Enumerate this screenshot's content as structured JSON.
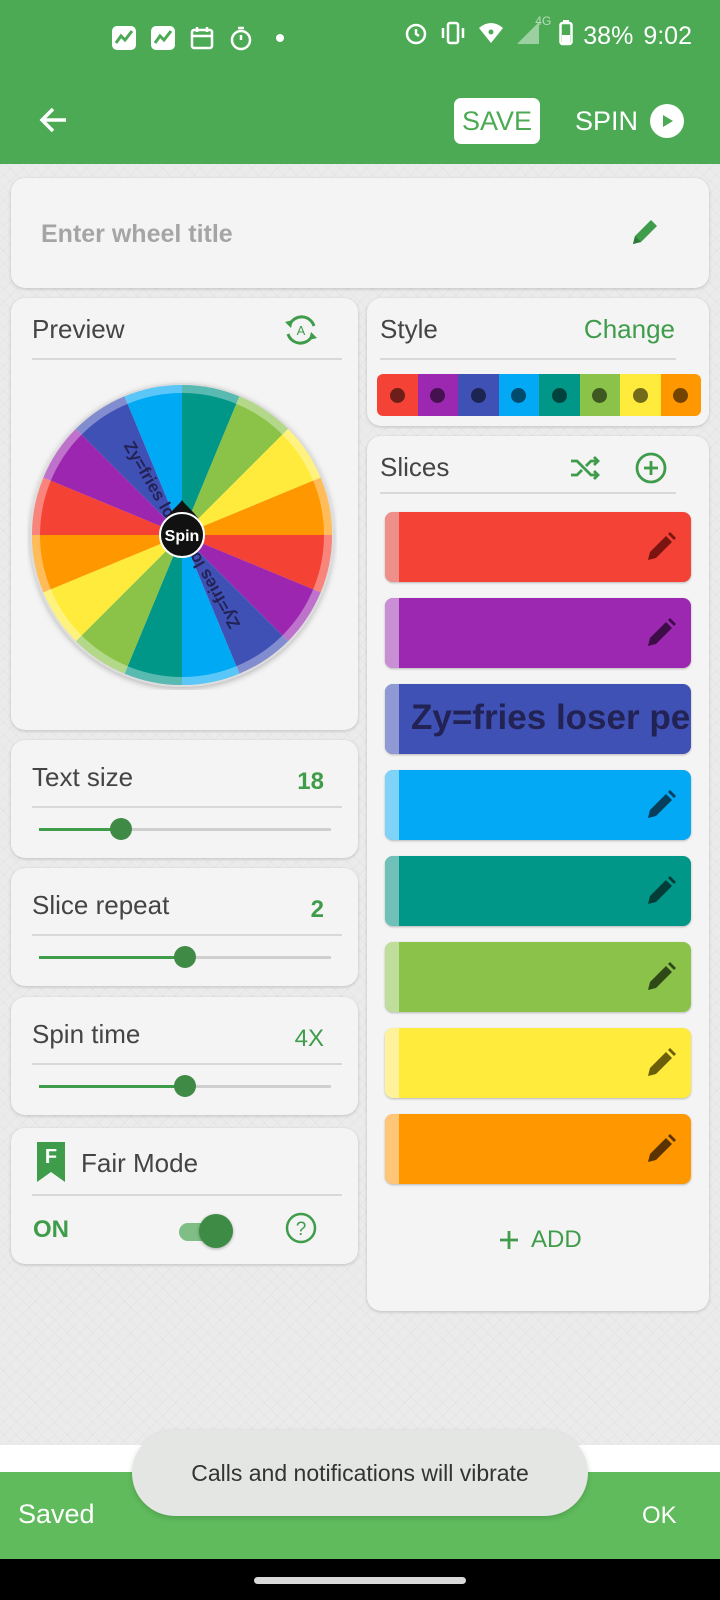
{
  "status_bar": {
    "battery": "38%",
    "time": "9:02",
    "network": "4G",
    "left_icons": [
      "chart-app-icon",
      "chart-app-icon",
      "calendar-icon",
      "timer-icon",
      "dot-icon"
    ],
    "right_icons": [
      "alarm-icon",
      "vibrate-icon",
      "wifi-icon",
      "signal-icon",
      "battery-icon"
    ]
  },
  "app_bar": {
    "save_label": "SAVE",
    "spin_label": "SPIN"
  },
  "title_field": {
    "placeholder": "Enter wheel title",
    "value": ""
  },
  "preview": {
    "title": "Preview",
    "center_label": "Spin",
    "wheel_text": "Zy=fries los"
  },
  "style": {
    "title": "Style",
    "change_label": "Change",
    "colors": [
      "#f44336",
      "#9c27b0",
      "#3f51b5",
      "#03a9f4",
      "#009688",
      "#8bc34a",
      "#ffeb3b",
      "#ff9800"
    ]
  },
  "slices": {
    "title": "Slices",
    "add_label": "ADD",
    "items": [
      {
        "color": "#f44336",
        "stripe": "#ee8f8a",
        "text": "",
        "pencil": "#7a1410"
      },
      {
        "color": "#9c27b0",
        "stripe": "#c98fd5",
        "text": "",
        "pencil": "#3d0d47"
      },
      {
        "color": "#3f51b5",
        "stripe": "#8f99d4",
        "text": "Zy=fries loser pe",
        "pencil": "#1a2150"
      },
      {
        "color": "#03a9f4",
        "stripe": "#7fd2f8",
        "text": "",
        "pencil": "#063e5c"
      },
      {
        "color": "#009688",
        "stripe": "#6fc0b8",
        "text": "",
        "pencil": "#033d37"
      },
      {
        "color": "#8bc34a",
        "stripe": "#bfdd9b",
        "text": "",
        "pencil": "#2f4818"
      },
      {
        "color": "#ffeb3b",
        "stripe": "#fff29a",
        "text": "",
        "pencil": "#6b5f0a"
      },
      {
        "color": "#ff9800",
        "stripe": "#ffc678",
        "text": "",
        "pencil": "#5a3300"
      }
    ]
  },
  "text_size": {
    "label": "Text size",
    "value": "18",
    "fraction": 0.28
  },
  "slice_repeat": {
    "label": "Slice repeat",
    "value": "2",
    "fraction": 0.5
  },
  "spin_time": {
    "label": "Spin time",
    "value": "4X",
    "fraction": 0.5
  },
  "fair_mode": {
    "label": "Fair Mode",
    "badge": "F",
    "state": "ON",
    "enabled": true
  },
  "snackbar": {
    "message": "Saved",
    "action": "OK"
  },
  "toast": {
    "message": "Calls and notifications will vibrate"
  }
}
